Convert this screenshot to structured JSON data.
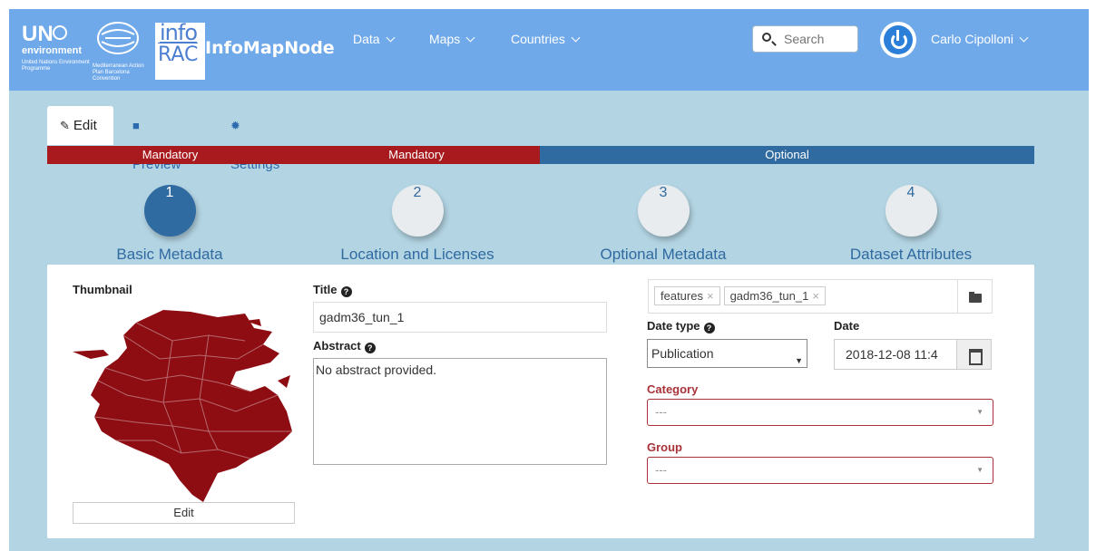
{
  "header": {
    "un_text": "UN",
    "environment_text": "environment",
    "un_subtitle": "United Nations Environment Programme",
    "map_subtitle": "Mediterranean Action Plan Barcelona Convention",
    "info_text": "info",
    "rac_text": "RAC",
    "brand_name": "InfoMapNode",
    "nav": [
      "Data",
      "Maps",
      "Countries"
    ],
    "search_placeholder": "Search",
    "user_name": "Carlo Cipolloni"
  },
  "tabs": {
    "edit": "Edit",
    "preview": "Preview",
    "settings": "Settings"
  },
  "progress": {
    "segments": [
      "Mandatory",
      "Mandatory",
      "Optional"
    ],
    "colors": {
      "mandatory": "#a81a1d",
      "optional": "#2f6aa0"
    }
  },
  "steps": [
    {
      "number": "1",
      "label": "Basic Metadata"
    },
    {
      "number": "2",
      "label": "Location and Licenses"
    },
    {
      "number": "3",
      "label": "Optional Metadata"
    },
    {
      "number": "4",
      "label": "Dataset Attributes"
    }
  ],
  "form": {
    "thumbnail_label": "Thumbnail",
    "thumbnail_edit": "Edit",
    "title_label": "Title",
    "title_value": "gadm36_tun_1",
    "abstract_label": "Abstract",
    "abstract_value": "No abstract provided.",
    "keywords": [
      "features",
      "gadm36_tun_1"
    ],
    "date_type_label": "Date type",
    "date_type_value": "Publication",
    "date_label": "Date",
    "date_value": "2018-12-08 11:4",
    "category_label": "Category",
    "category_placeholder": "---",
    "group_label": "Group",
    "group_placeholder": "---"
  }
}
